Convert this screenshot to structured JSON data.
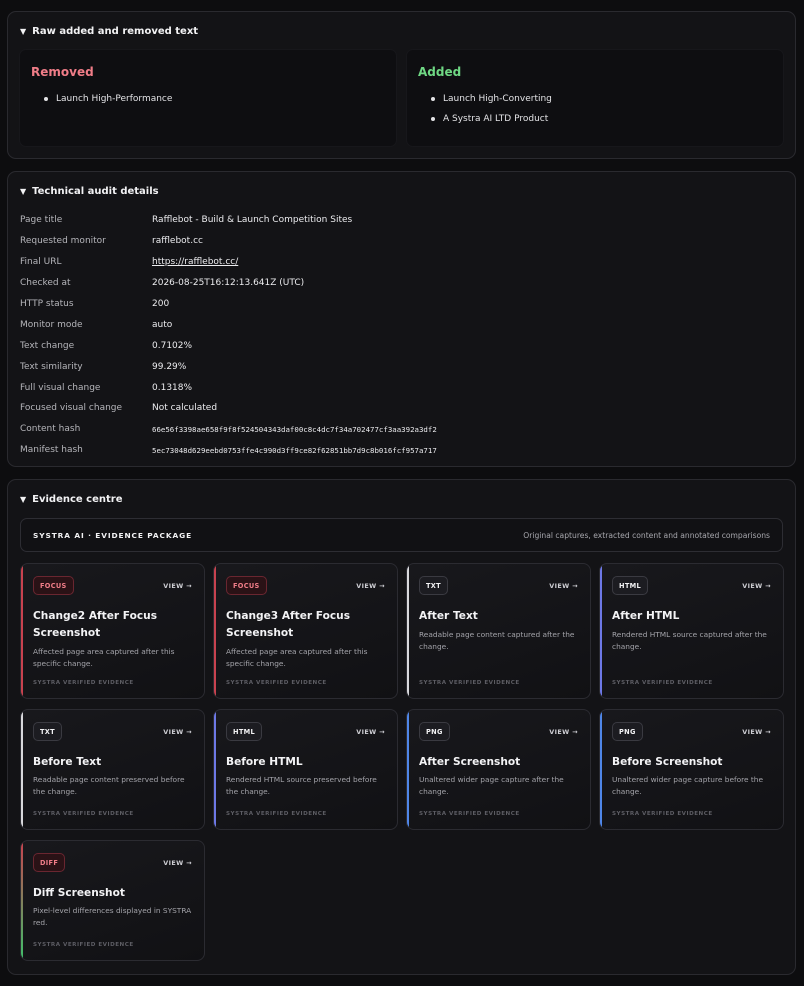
{
  "raw_text": {
    "heading": "Raw added and removed text",
    "removed": {
      "title": "Removed",
      "items": [
        "Launch High-Performance"
      ],
      "color": "#f07d88"
    },
    "added": {
      "title": "Added",
      "items": [
        "Launch High-Converting",
        "A Systra AI LTD Product"
      ],
      "color": "#6fd884"
    }
  },
  "audit": {
    "heading": "Technical audit details",
    "rows": [
      {
        "key": "Page title",
        "value": "Rafflebot - Build & Launch Competition Sites"
      },
      {
        "key": "Requested monitor",
        "value": "rafflebot.cc"
      },
      {
        "key": "Final URL",
        "value": "https://rafflebot.cc/"
      },
      {
        "key": "Checked at",
        "value": "2026-08-25T16:12:13.641Z (UTC)"
      },
      {
        "key": "HTTP status",
        "value": "200"
      },
      {
        "key": "Monitor mode",
        "value": "auto"
      },
      {
        "key": "Text change",
        "value": "0.7102%"
      },
      {
        "key": "Text similarity",
        "value": "99.29%"
      },
      {
        "key": "Full visual change",
        "value": "0.1318%"
      },
      {
        "key": "Focused visual change",
        "value": "Not calculated"
      },
      {
        "key": "Content hash",
        "value": "66e56f3398ae658f9f8f524504343daf00c8c4dc7f34a702477cf3aa392a3df2"
      },
      {
        "key": "Manifest hash",
        "value": "5ec73048d629eebd0753ffe4c990d3ff9ce82f62851bb7d9c8b016fcf957a717"
      }
    ]
  },
  "evidence": {
    "heading": "Evidence centre",
    "package_title": "SYSTRA AI · EVIDENCE PACKAGE",
    "package_subtitle": "Original captures, extracted content and annotated comparisons",
    "view_label": "VIEW →",
    "footer_label": "SYSTRA VERIFIED EVIDENCE",
    "cards": [
      {
        "badge": "FOCUS",
        "title": "Change2 After Focus Screenshot",
        "desc": "Affected page area captured after this specific change.",
        "accent": "#c8424f"
      },
      {
        "badge": "FOCUS",
        "title": "Change3 After Focus Screenshot",
        "desc": "Affected page area captured after this specific change.",
        "accent": "#c8424f"
      },
      {
        "badge": "TXT",
        "title": "After Text",
        "desc": "Readable page content captured after the change.",
        "accent": "#d8d8dc"
      },
      {
        "badge": "HTML",
        "title": "After HTML",
        "desc": "Rendered HTML source captured after the change.",
        "accent": "#6d78e6"
      },
      {
        "badge": "TXT",
        "title": "Before Text",
        "desc": "Readable page content preserved before the change.",
        "accent": "#d8d8dc"
      },
      {
        "badge": "HTML",
        "title": "Before HTML",
        "desc": "Rendered HTML source preserved before the change.",
        "accent": "#6d78e6"
      },
      {
        "badge": "PNG",
        "title": "After Screenshot",
        "desc": "Unaltered wider page capture after the change.",
        "accent": "#4f86e8"
      },
      {
        "badge": "PNG",
        "title": "Before Screenshot",
        "desc": "Unaltered wider page capture before the change.",
        "accent": "#4f86e8"
      },
      {
        "badge": "DIFF",
        "title": "Diff Screenshot",
        "desc": "Pixel-level differences displayed in SYSTRA red.",
        "accent": "linear-gradient(#c8424f,#3fbf6a)"
      }
    ]
  }
}
